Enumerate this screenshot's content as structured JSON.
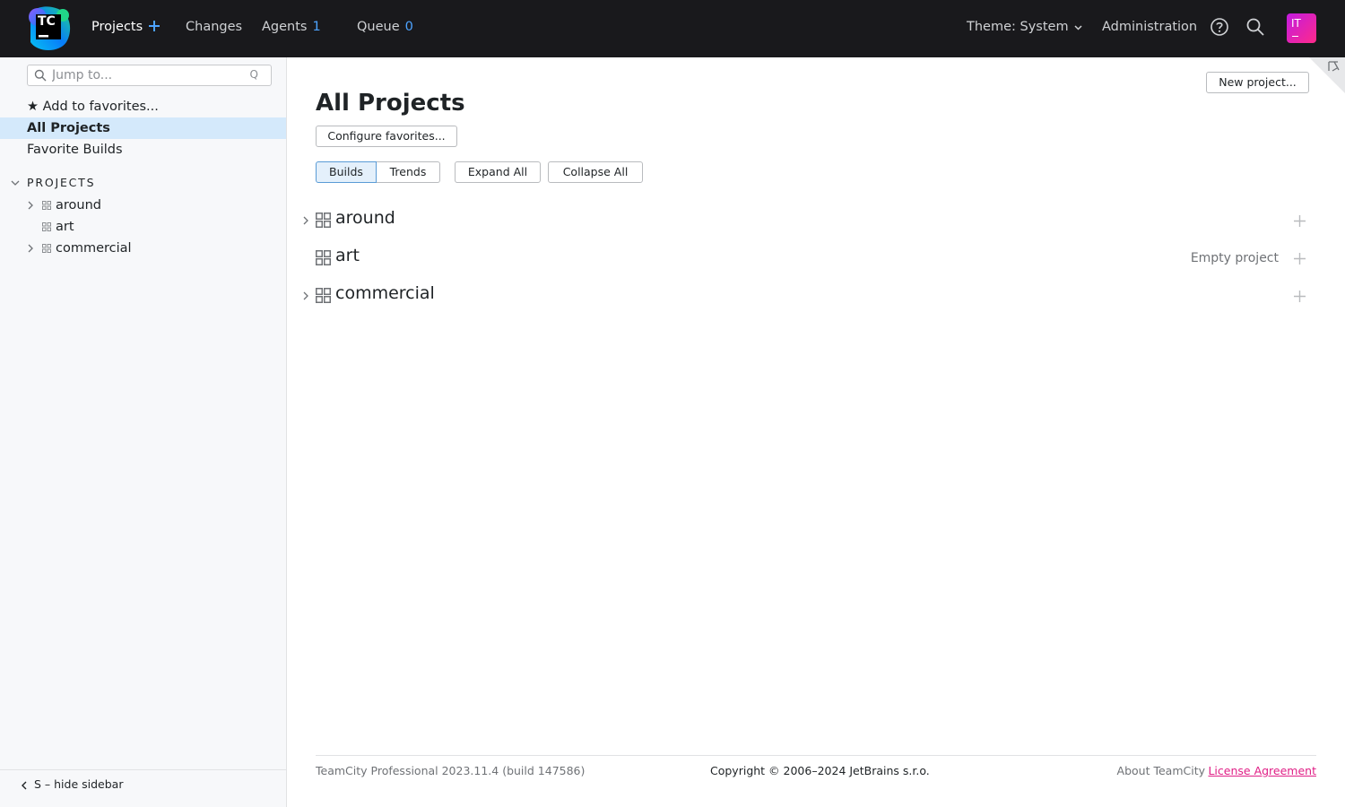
{
  "header": {
    "logo_text": "TC",
    "nav": {
      "projects": "Projects",
      "changes": "Changes",
      "agents": "Agents",
      "agents_count": "1",
      "queue": "Queue",
      "queue_count": "0"
    },
    "theme": "Theme: System",
    "administration": "Administration",
    "avatar_initials": "IT",
    "icons": [
      "plus-icon",
      "help-icon",
      "search-icon",
      "chevron-down-icon"
    ],
    "accent_color": "#4da3ff",
    "avatar_color": "#d81fc0"
  },
  "sidebar": {
    "search_placeholder": "Jump to...",
    "search_shortcut": "Q",
    "add_to_favorites": "★ Add to favorites...",
    "all_projects": "All Projects",
    "favorite_builds": "Favorite Builds",
    "section_title": "PROJECTS",
    "projects": [
      {
        "name": "around",
        "expandable": true
      },
      {
        "name": "art",
        "expandable": false
      },
      {
        "name": "commercial",
        "expandable": true
      }
    ],
    "hide_sidebar": "S – hide sidebar",
    "selected_color": "#d4e9fb"
  },
  "main": {
    "title": "All Projects",
    "new_project": "New project...",
    "configure_favorites": "Configure favorites...",
    "view_tabs": {
      "builds": "Builds",
      "trends": "Trends",
      "selected": "Builds"
    },
    "expand_all": "Expand All",
    "collapse_all": "Collapse All",
    "projects": [
      {
        "name": "around",
        "status": "",
        "expandable": true
      },
      {
        "name": "art",
        "status": "Empty project",
        "expandable": false
      },
      {
        "name": "commercial",
        "status": "",
        "expandable": true
      }
    ]
  },
  "footer": {
    "version": "TeamCity Professional 2023.11.4 (build 147586)",
    "copyright": "Copyright © 2006–2024 JetBrains s.r.o.",
    "about": "About TeamCity",
    "license": "License Agreement",
    "license_color": "#e01f86"
  }
}
